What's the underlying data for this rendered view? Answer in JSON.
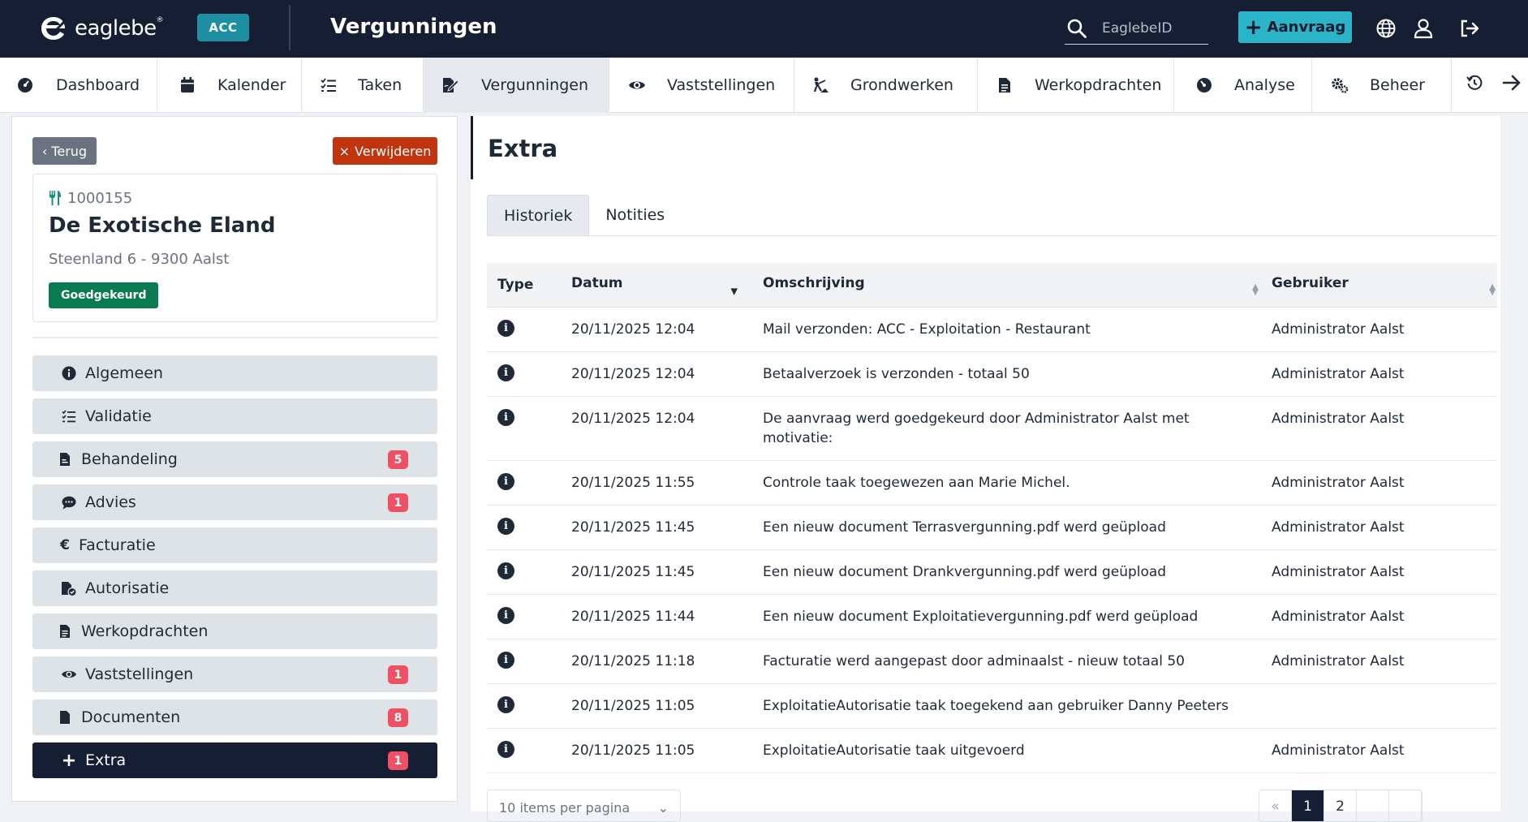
{
  "header": {
    "logo_text": "eaglebe",
    "logo_sup": "®",
    "env_badge": "ACC",
    "title": "Vergunningen",
    "search_placeholder": "EaglebeID",
    "request_button": "Aanvraag",
    "icons": [
      "globe-icon",
      "user-icon",
      "logout-icon"
    ]
  },
  "nav": {
    "items": [
      {
        "label": "Dashboard",
        "icon": "dashboard-icon"
      },
      {
        "label": "Kalender",
        "icon": "calendar-icon"
      },
      {
        "label": "Taken",
        "icon": "tasks-icon"
      },
      {
        "label": "Vergunningen",
        "icon": "permit-icon",
        "active": true
      },
      {
        "label": "Vaststellingen",
        "icon": "eye-icon"
      },
      {
        "label": "Grondwerken",
        "icon": "digging-icon"
      },
      {
        "label": "Werkopdrachten",
        "icon": "document-icon"
      },
      {
        "label": "Analyse",
        "icon": "analysis-icon"
      },
      {
        "label": "Beheer",
        "icon": "cogs-icon"
      }
    ],
    "trail_icons": [
      "history-icon",
      "arrow-right-icon"
    ]
  },
  "left": {
    "back_label": "Terug",
    "delete_label": "Verwijderen",
    "place": {
      "id": "1000155",
      "name": "De Exotische Eland",
      "address": "Steenland 6 - 9300 Aalst",
      "status": "Goedgekeurd"
    },
    "menu": [
      {
        "label": "Algemeen",
        "icon": "info-icon",
        "badge": ""
      },
      {
        "label": "Validatie",
        "icon": "checklist-icon",
        "badge": ""
      },
      {
        "label": "Behandeling",
        "icon": "file-icon",
        "badge": "5"
      },
      {
        "label": "Advies",
        "icon": "comment-icon",
        "badge": "1"
      },
      {
        "label": "Facturatie",
        "icon": "euro-icon",
        "badge": ""
      },
      {
        "label": "Autorisatie",
        "icon": "file-check-icon",
        "badge": ""
      },
      {
        "label": "Werkopdrachten",
        "icon": "document-icon",
        "badge": ""
      },
      {
        "label": "Vaststellingen",
        "icon": "eye-icon",
        "badge": "1"
      },
      {
        "label": "Documenten",
        "icon": "file-icon",
        "badge": "8"
      },
      {
        "label": "Extra",
        "icon": "plus-icon",
        "badge": "1",
        "active": true
      }
    ]
  },
  "main": {
    "title": "Extra",
    "tabs": [
      {
        "label": "Historiek",
        "active": true
      },
      {
        "label": "Notities",
        "active": false
      }
    ],
    "columns": [
      "Type",
      "Datum",
      "Omschrijving",
      "Gebruiker"
    ],
    "rows": [
      {
        "date": "20/11/2025 12:04",
        "desc": "Mail verzonden: ACC - Exploitation - Restaurant",
        "user": "Administrator Aalst"
      },
      {
        "date": "20/11/2025 12:04",
        "desc": "Betaalverzoek is verzonden - totaal 50",
        "user": "Administrator Aalst"
      },
      {
        "date": "20/11/2025 12:04",
        "desc": "De aanvraag werd goedgekeurd door Administrator Aalst met motivatie:",
        "user": "Administrator Aalst"
      },
      {
        "date": "20/11/2025 11:55",
        "desc": "Controle taak toegewezen aan Marie Michel.",
        "user": "Administrator Aalst"
      },
      {
        "date": "20/11/2025 11:45",
        "desc": "Een nieuw document Terrasvergunning.pdf werd geüpload",
        "user": "Administrator Aalst"
      },
      {
        "date": "20/11/2025 11:45",
        "desc": "Een nieuw document Drankvergunning.pdf werd geüpload",
        "user": "Administrator Aalst"
      },
      {
        "date": "20/11/2025 11:44",
        "desc": "Een nieuw document Exploitatievergunning.pdf werd geüpload",
        "user": "Administrator Aalst"
      },
      {
        "date": "20/11/2025 11:18",
        "desc": "Facturatie werd aangepast door adminaalst - nieuw totaal 50",
        "user": "Administrator Aalst"
      },
      {
        "date": "20/11/2025 11:05",
        "desc": "ExploitatieAutorisatie taak toegekend aan gebruiker Danny Peeters",
        "user": ""
      },
      {
        "date": "20/11/2025 11:05",
        "desc": "ExploitatieAutorisatie taak uitgevoerd",
        "user": "Administrator Aalst"
      }
    ],
    "page_size_label": "10 items per pagina",
    "pager": {
      "prev": "«",
      "current": "1",
      "next_page": "2"
    }
  },
  "colors": {
    "topbar": "#161e33",
    "accent": "#2bb3c7",
    "env_badge": "#1c8fa3",
    "delete": "#c0350d",
    "approved": "#0a7b4e",
    "badge": "#f05064"
  }
}
